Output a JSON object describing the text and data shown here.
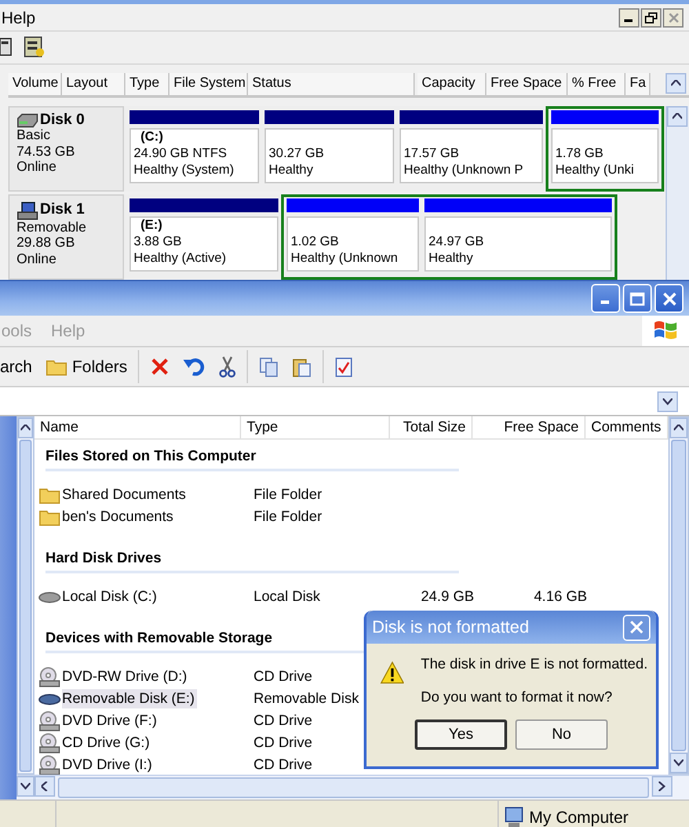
{
  "disk_manager": {
    "menu": [
      "Help"
    ],
    "columns": [
      "Volume",
      "Layout",
      "Type",
      "File System",
      "Status",
      "Capacity",
      "Free Space",
      "% Free",
      "Fa"
    ],
    "disks": [
      {
        "name": "Disk 0",
        "kind": "fixed",
        "type": "Basic",
        "size": "74.53 GB",
        "status": "Online",
        "partitions": [
          {
            "label": "(C:)",
            "size": "24.90 GB NTFS",
            "status": "Healthy (System)",
            "kind": "primary"
          },
          {
            "size": "30.27 GB",
            "status": "Healthy",
            "kind": "primary"
          },
          {
            "size": "17.57 GB",
            "status": "Healthy (Unknown P",
            "kind": "primary"
          },
          {
            "size": "1.78 GB",
            "status": "Healthy (Unki",
            "kind": "logical"
          }
        ]
      },
      {
        "name": "Disk 1",
        "kind": "removable",
        "type": "Removable",
        "size": "29.88 GB",
        "status": "Online",
        "partitions": [
          {
            "label": "(E:)",
            "size": "3.88 GB",
            "status": "Healthy (Active)",
            "kind": "primary"
          },
          {
            "size": "1.02 GB",
            "status": "Healthy (Unknown",
            "kind": "logical"
          },
          {
            "size": "24.97 GB",
            "status": "Healthy",
            "kind": "logical"
          }
        ]
      }
    ]
  },
  "explorer": {
    "menu": [
      "ools",
      "Help"
    ],
    "toolbar": [
      {
        "kind": "text",
        "label": "arch"
      },
      {
        "kind": "folders",
        "label": "Folders"
      },
      {
        "kind": "separator"
      },
      {
        "kind": "delete"
      },
      {
        "kind": "undo"
      },
      {
        "kind": "cut"
      },
      {
        "kind": "separator"
      },
      {
        "kind": "copy"
      },
      {
        "kind": "paste"
      },
      {
        "kind": "separator"
      },
      {
        "kind": "properties"
      }
    ],
    "columns": [
      "Name",
      "Type",
      "Total Size",
      "Free Space",
      "Comments"
    ],
    "groups": [
      {
        "title": "Files Stored on This Computer",
        "items": [
          {
            "name": "Shared Documents",
            "type": "File Folder",
            "kind": "folder",
            "selected": false
          },
          {
            "name": "ben's Documents",
            "type": "File Folder",
            "kind": "folder",
            "selected": false
          }
        ]
      },
      {
        "title": "Hard Disk Drives",
        "items": [
          {
            "name": "Local Disk (C:)",
            "type": "Local Disk",
            "total_size": "24.9 GB",
            "free_space": "4.16 GB",
            "kind": "harddisk",
            "selected": false
          }
        ]
      },
      {
        "title": "Devices with Removable Storage",
        "items": [
          {
            "name": "DVD-RW Drive (D:)",
            "type": "CD Drive",
            "kind": "cd",
            "selected": false
          },
          {
            "name": "Removable Disk (E:)",
            "type": "Removable Disk",
            "kind": "removable",
            "selected": true
          },
          {
            "name": "DVD Drive (F:)",
            "type": "CD Drive",
            "kind": "cd",
            "selected": false
          },
          {
            "name": "CD Drive (G:)",
            "type": "CD Drive",
            "kind": "cd",
            "selected": false
          },
          {
            "name": "DVD Drive (I:)",
            "type": "CD Drive",
            "kind": "cd",
            "selected": false
          }
        ]
      }
    ],
    "status_bar": {
      "location": "My Computer"
    }
  },
  "dialog": {
    "title": "Disk is not formatted",
    "lines": [
      "The disk in drive E is not formatted.",
      "Do you want to format it now?"
    ],
    "buttons": [
      {
        "label": "Yes",
        "default": true
      },
      {
        "label": "No",
        "default": false
      }
    ]
  }
}
